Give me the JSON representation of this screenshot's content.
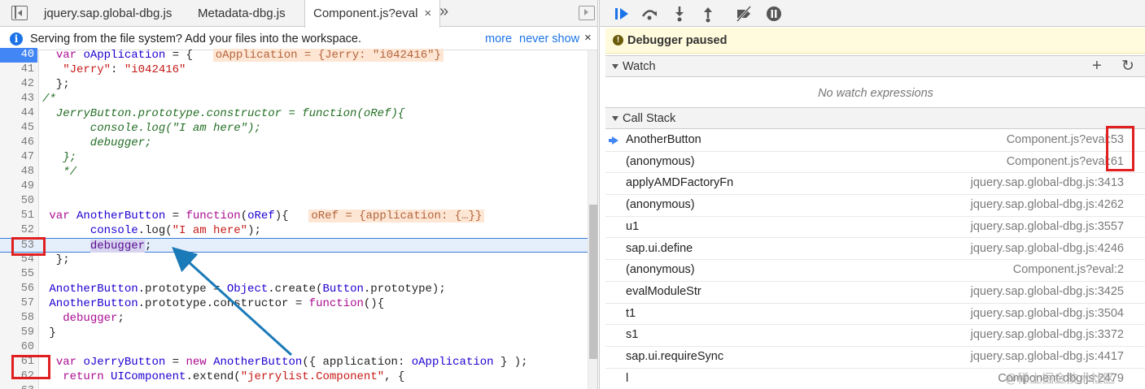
{
  "editor_tabs": {
    "items": [
      "jquery.sap.global-dbg.js",
      "Metadata-dbg.js",
      "Component.js?eval"
    ],
    "close_glyph": "×",
    "more_glyph": "»"
  },
  "infobar": {
    "message": "Serving from the file system? Add your files into the workspace.",
    "more": "more",
    "never_show": "never show",
    "close_glyph": "×",
    "icon_glyph": "i"
  },
  "code_lines": [
    {
      "n": "40",
      "html": "  <span class=\"kw\">var</span> <span class=\"var\">oApplication</span> = {  <span class=\"inline-val\">oApplication = {Jerry: \"i042416\"}</span>"
    },
    {
      "n": "41",
      "html": "   <span class=\"str\">\"Jerry\"</span>: <span class=\"str\">\"i042416\"</span>"
    },
    {
      "n": "42",
      "html": "  };"
    },
    {
      "n": "43",
      "html": "<span class=\"cmt\">/*</span>"
    },
    {
      "n": "44",
      "html": "<span class=\"cmt\">  JerryButton.prototype.constructor = function(oRef){</span>"
    },
    {
      "n": "45",
      "html": "<span class=\"cmt\">       console.log(\"I am here\");</span>"
    },
    {
      "n": "46",
      "html": "<span class=\"cmt\">       debugger;</span>"
    },
    {
      "n": "47",
      "html": "<span class=\"cmt\">   };</span>"
    },
    {
      "n": "48",
      "html": "<span class=\"cmt\">   */</span>"
    },
    {
      "n": "49",
      "html": ""
    },
    {
      "n": "50",
      "html": ""
    },
    {
      "n": "51",
      "html": " <span class=\"kw\">var</span> <span class=\"var\">AnotherButton</span> = <span class=\"kw\">function</span>(<span class=\"var\">oRef</span>){  <span class=\"inline-val\">oRef = {application: {…}}</span>"
    },
    {
      "n": "52",
      "html": "       <span class=\"var\">console</span>.log(<span class=\"str\">\"I am here\"</span>);"
    },
    {
      "n": "53",
      "html": "       <span class=\"sel\">debugger</span>;"
    },
    {
      "n": "54",
      "html": "  };"
    },
    {
      "n": "55",
      "html": ""
    },
    {
      "n": "56",
      "html": " <span class=\"var\">AnotherButton</span>.prototype = <span class=\"var\">Object</span>.create(<span class=\"var\">Button</span>.prototype);"
    },
    {
      "n": "57",
      "html": " <span class=\"var\">AnotherButton</span>.prototype.constructor = <span class=\"kw\">function</span>(){"
    },
    {
      "n": "58",
      "html": "   <span class=\"kw\">debugger</span>;"
    },
    {
      "n": "59",
      "html": " }"
    },
    {
      "n": "60",
      "html": ""
    },
    {
      "n": "61",
      "html": "  <span class=\"kw\">var</span> <span class=\"var\">oJerryButton</span> = <span class=\"kw\">new</span> <span class=\"var\">AnotherButton</span>({ application: <span class=\"var\">oApplication</span> } );"
    },
    {
      "n": "62",
      "html": "   <span class=\"kw\">return</span> <span class=\"var\">UIComponent</span>.extend(<span class=\"str\">\"jerrylist.Component\"</span>, {"
    },
    {
      "n": "63",
      "html": ""
    }
  ],
  "debugger": {
    "paused_label": "Debugger paused",
    "watch_title": "Watch",
    "no_watch": "No watch expressions",
    "callstack_title": "Call Stack",
    "add_glyph": "+",
    "refresh_glyph": "↻",
    "pause_icon_glyph": "!"
  },
  "call_stack": [
    {
      "name": "AnotherButton",
      "loc": "Component.js?eval:53",
      "current": true
    },
    {
      "name": "(anonymous)",
      "loc": "Component.js?eval:61",
      "current": false
    },
    {
      "name": "applyAMDFactoryFn",
      "loc": "jquery.sap.global-dbg.js:3413",
      "current": false
    },
    {
      "name": "(anonymous)",
      "loc": "jquery.sap.global-dbg.js:4262",
      "current": false
    },
    {
      "name": "u1",
      "loc": "jquery.sap.global-dbg.js:3557",
      "current": false
    },
    {
      "name": "sap.ui.define",
      "loc": "jquery.sap.global-dbg.js:4246",
      "current": false
    },
    {
      "name": "(anonymous)",
      "loc": "Component.js?eval:2",
      "current": false
    },
    {
      "name": "evalModuleStr",
      "loc": "jquery.sap.global-dbg.js:3425",
      "current": false
    },
    {
      "name": "t1",
      "loc": "jquery.sap.global-dbg.js:3504",
      "current": false
    },
    {
      "name": "s1",
      "loc": "jquery.sap.global-dbg.js:3372",
      "current": false
    },
    {
      "name": "sap.ui.requireSync",
      "loc": "jquery.sap.global-dbg.js:4417",
      "current": false
    },
    {
      "name": "l",
      "loc": "Component-dbg.js:2479",
      "current": false
    }
  ],
  "watermark": "@稀土掘金技术社区",
  "colors": {
    "annotation_red": "#e02020",
    "arrow_blue": "#1b7ab8",
    "breakpoint_blue": "#4285f4",
    "paused_banner": "#fffbdc"
  }
}
